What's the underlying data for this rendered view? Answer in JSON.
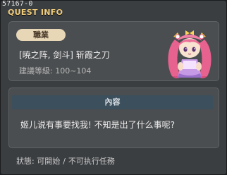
{
  "window": {
    "quest_id": "57167-0",
    "title": "QUEST INFO"
  },
  "quest": {
    "job_label": "職業",
    "name": "[暁之阵, 剑斗] 斩霞之刀",
    "level_label": "建議等級",
    "level_value": "100~104",
    "npc_icon": "pink-haired-princess-npc-portrait"
  },
  "content": {
    "header": "內容",
    "text": "姬儿说有事要找我! 不知是出了什么事呢?"
  },
  "status": {
    "label": "狀態",
    "start_state": "可開始",
    "separator": "/",
    "complete_state": "不可执行任務"
  },
  "colors": {
    "title": "#f1ce7d",
    "job_badge": "#e8d7b7",
    "content_header_bg": "#3b4f5c"
  }
}
